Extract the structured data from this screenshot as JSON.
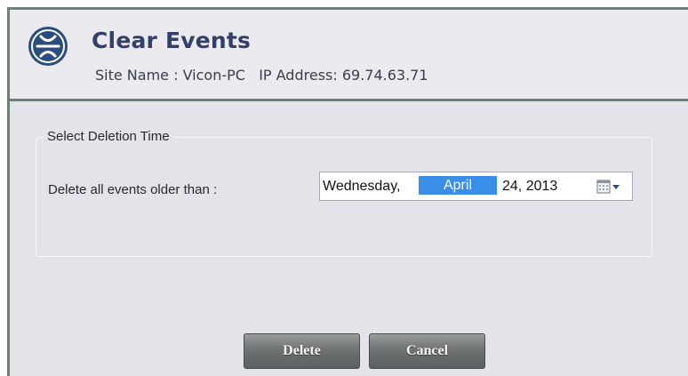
{
  "dialog": {
    "title": "Clear Events",
    "subtitle": "Site Name : Vicon-PC   IP Address: 69.74.63.71",
    "logo_icon": "vicon-logo-icon"
  },
  "group": {
    "legend": "Select Deletion Time",
    "field_label": "Delete all events older than :",
    "date_picker": {
      "weekday": "Wednesday,",
      "month": "April",
      "day_year": "24, 2013",
      "selected_segment": "month",
      "button_icon": "calendar-dropdown-icon"
    }
  },
  "buttons": {
    "delete": "Delete",
    "cancel": "Cancel"
  },
  "colors": {
    "title": "#33406a",
    "selection": "#3a8ee6",
    "button_bg": "#6f7272"
  }
}
